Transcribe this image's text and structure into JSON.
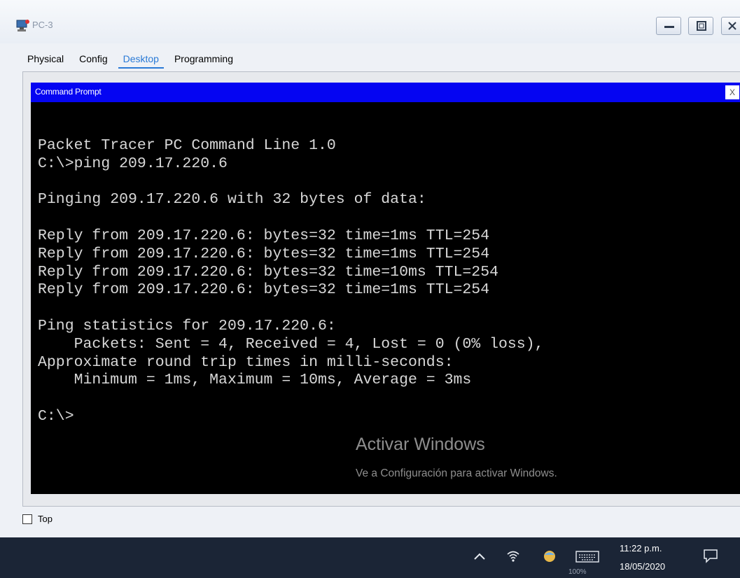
{
  "window": {
    "title": "PC-3",
    "icon": "packet-tracer-pc-icon",
    "controls": [
      "minimize-icon",
      "maximize-icon",
      "close-icon"
    ]
  },
  "tabs": [
    {
      "label": "Physical",
      "active": false
    },
    {
      "label": "Config",
      "active": false
    },
    {
      "label": "Desktop",
      "active": true
    },
    {
      "label": "Programming",
      "active": false
    }
  ],
  "command_prompt": {
    "title": "Command Prompt",
    "close_label": "X",
    "text": "Packet Tracer PC Command Line 1.0\nC:\\>ping 209.17.220.6\n\nPinging 209.17.220.6 with 32 bytes of data:\n\nReply from 209.17.220.6: bytes=32 time=1ms TTL=254\nReply from 209.17.220.6: bytes=32 time=1ms TTL=254\nReply from 209.17.220.6: bytes=32 time=10ms TTL=254\nReply from 209.17.220.6: bytes=32 time=1ms TTL=254\n\nPing statistics for 209.17.220.6:\n    Packets: Sent = 4, Received = 4, Lost = 0 (0% loss),\nApproximate round trip times in milli-seconds:\n    Minimum = 1ms, Maximum = 10ms, Average = 3ms\n\nC:\\>"
  },
  "watermark": {
    "title": "Activar Windows",
    "subtitle": "Ve a Configuración para activar Windows."
  },
  "top_checkbox": {
    "label": "Top",
    "checked": false
  },
  "taskbar": {
    "time": "11:22 p.m.",
    "date": "18/05/2020",
    "zoom": "100%",
    "tray_icons": [
      "chevron-up-icon",
      "wifi-icon",
      "app-tray-icon",
      "keyboard-icon",
      "notification-icon"
    ]
  },
  "colors": {
    "cmd_titlebar": "#0505f2",
    "console_bg": "#000000",
    "console_text": "#d8d8d8",
    "active_tab": "#2a7ad6",
    "taskbar": "#1b2536"
  }
}
